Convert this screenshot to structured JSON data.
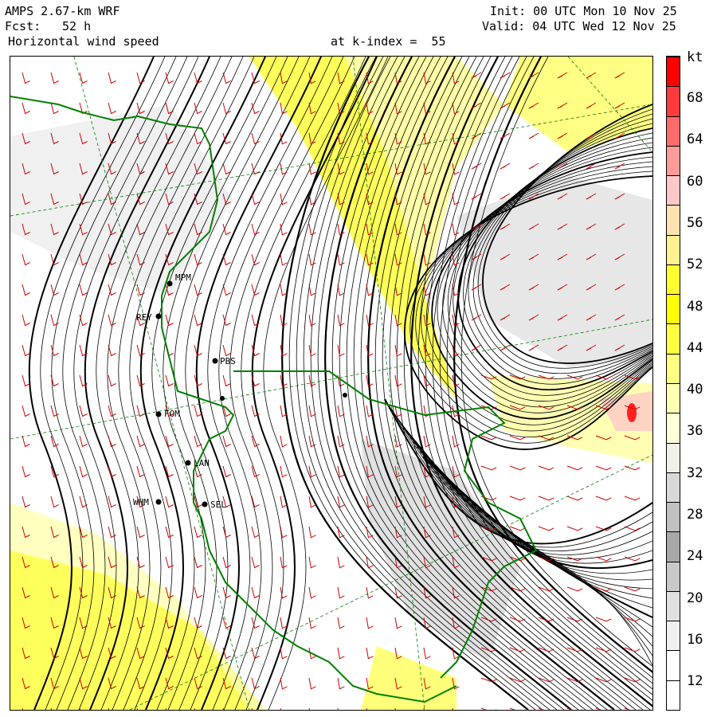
{
  "header": {
    "model": "AMPS 2.67-km WRF",
    "init": "Init: 00 UTC Mon 10 Nov 25",
    "forecast_label": "Fcst:",
    "forecast_hours": "52 h",
    "valid": "Valid: 04 UTC Wed 12 Nov 25",
    "field": "Horizontal wind speed",
    "level": "at k-index =  55"
  },
  "colorbar": {
    "unit": "kt",
    "labels": [
      "68",
      "64",
      "60",
      "56",
      "52",
      "48",
      "44",
      "40",
      "36",
      "32",
      "28",
      "24",
      "20",
      "16",
      "12"
    ],
    "colors": [
      "#ff0000",
      "#ff3a3a",
      "#ff6a6a",
      "#ff9a9a",
      "#ffc8c8",
      "#ffe2b0",
      "#fff090",
      "#ffff30",
      "#ffff00",
      "#ffff40",
      "#ffff80",
      "#ffffb0",
      "#ffffd8",
      "#f0f0e8",
      "#d8d8d8",
      "#c0c0c0",
      "#a8a8a8",
      "#c8c8c8",
      "#e0e0e0",
      "#f0f0f0",
      "#ffffff",
      "#ffffff"
    ]
  },
  "stations": [
    {
      "code": "REY"
    },
    {
      "code": "FOM"
    },
    {
      "code": "LAN"
    },
    {
      "code": "WHM"
    },
    {
      "code": "SEL"
    },
    {
      "code": "PBS"
    },
    {
      "code": "MPM"
    }
  ]
}
